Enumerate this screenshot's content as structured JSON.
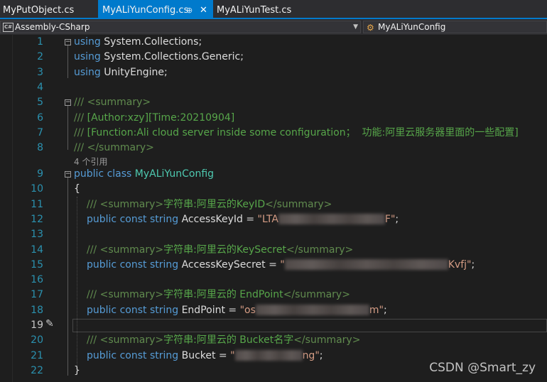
{
  "tabs": [
    {
      "label": "MyPutObject.cs",
      "active": false
    },
    {
      "label": "MyALiYunConfig.cs",
      "active": true
    },
    {
      "label": "MyALiYunTest.cs",
      "active": false
    }
  ],
  "tab_icons": {
    "pin": "⊕",
    "close": "✕"
  },
  "navbar": {
    "project": "Assembly-CSharp",
    "project_icon": "C#",
    "class": "MyALiYunConfig",
    "class_icon": "class-icon"
  },
  "code": {
    "line_numbers": [
      "1",
      "2",
      "3",
      "4",
      "5",
      "6",
      "7",
      "8",
      "9",
      "10",
      "11",
      "12",
      "13",
      "14",
      "15",
      "16",
      "17",
      "18",
      "19",
      "20",
      "21",
      "22"
    ],
    "l1": {
      "kw": "using",
      "ns": " System.Collections;"
    },
    "l2": {
      "kw": "using",
      "ns": " System.Collections.Generic;"
    },
    "l3": {
      "kw": "using",
      "ns": " UnityEngine;"
    },
    "l5": {
      "slashes": "///",
      "tag": " <summary>"
    },
    "l6": {
      "slashes": "///",
      "text": " [Author:xzy][Time:20210904]"
    },
    "l7": {
      "slashes": "///",
      "text": " [Function:Ali cloud server inside some configuration；  功能:阿里云服务器里面的一些配置]"
    },
    "l8": {
      "slashes": "///",
      "tag": " </summary>"
    },
    "codelens": "4 个引用",
    "l9": {
      "kw": "public class",
      "name": "MyALiYunConfig"
    },
    "l10": {
      "brace": "{"
    },
    "l11": {
      "slashes": "///",
      "open": " <summary>",
      "text": "字符串:阿里云的KeyID",
      "close": "</summary>"
    },
    "l12": {
      "kw": "public const string",
      "field": " AccessKeyId = ",
      "q1": "\"LTA",
      "q2": "F\"",
      "end": ";"
    },
    "l14": {
      "slashes": "///",
      "open": " <summary>",
      "text": "字符串:阿里云的KeySecret",
      "close": "</summary>"
    },
    "l15": {
      "kw": "public const string",
      "field": " AccessKeySecret = ",
      "q1": "\"",
      "q2": "Kvfj\"",
      "end": ";"
    },
    "l17": {
      "slashes": "///",
      "open": " <summary>",
      "text": "字符串:阿里云的 EndPoint",
      "close": "</summary>"
    },
    "l18": {
      "kw": "public const string",
      "field": " EndPoint = ",
      "q1": "\"os",
      "q2": "m\"",
      "end": ";"
    },
    "l20": {
      "slashes": "///",
      "open": " <summary>",
      "text": "字符串:阿里云的 Bucket名字",
      "close": "</summary>"
    },
    "l21": {
      "kw": "public const string",
      "field": " Bucket = ",
      "q1": "\"",
      "q2": "ng\"",
      "end": ";"
    },
    "l22": {
      "brace": "}"
    }
  },
  "watermark": "CSDN @Smart_zy",
  "colors": {
    "accent": "#007acc",
    "keyword": "#569cd6",
    "type": "#4ec9b0",
    "comment": "#57a64a",
    "string": "#d69d85",
    "line_number": "#2b91af"
  }
}
